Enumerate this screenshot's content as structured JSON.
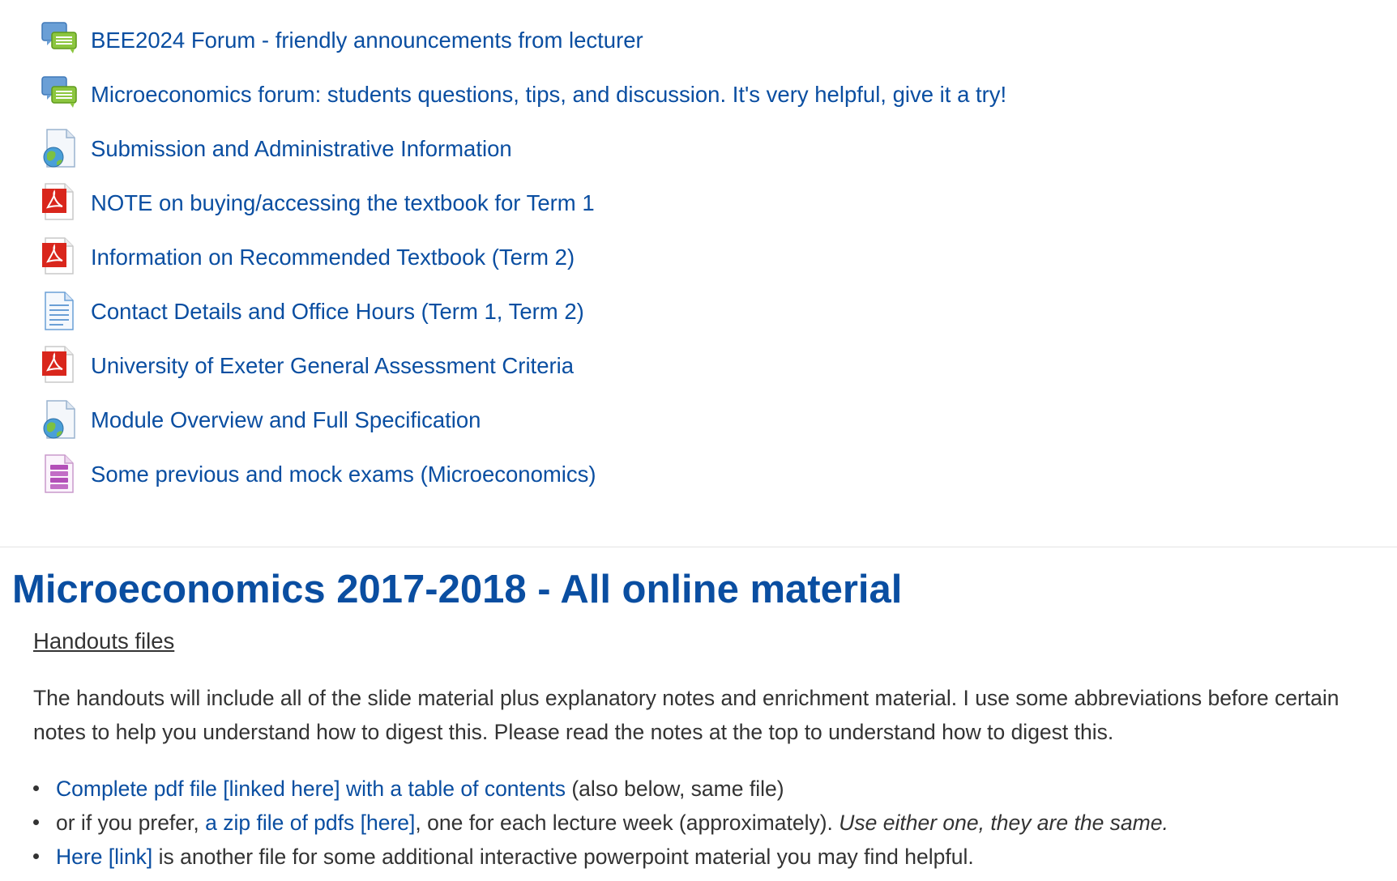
{
  "activities": [
    {
      "label": "BEE2024 Forum - friendly announcements from lecturer",
      "icon": "forum-icon"
    },
    {
      "label": "Microeconomics forum: students questions, tips, and discussion. It's very helpful, give it a try!",
      "icon": "forum-icon"
    },
    {
      "label": "Submission and Administrative Information",
      "icon": "url-globe-icon"
    },
    {
      "label": "NOTE on buying/accessing the textbook for Term 1",
      "icon": "pdf-icon"
    },
    {
      "label": "Information on Recommended Textbook (Term 2)",
      "icon": "pdf-icon"
    },
    {
      "label": "Contact Details and Office Hours (Term 1, Term 2)",
      "icon": "page-icon"
    },
    {
      "label": "University of Exeter General Assessment Criteria",
      "icon": "pdf-icon"
    },
    {
      "label": "Module Overview and Full Specification",
      "icon": "url-globe-icon"
    },
    {
      "label": "Some previous and mock exams (Microeconomics)",
      "icon": "archive-icon"
    }
  ],
  "section": {
    "title": "Microeconomics 2017-2018 - All online material",
    "handouts_heading": "Handouts files",
    "intro": "The handouts will include all of the slide material plus explanatory notes and enrichment material. I use some abbreviations before certain notes to help you understand how to digest this. Please read the notes at the top to understand how to digest this.",
    "bullets": [
      {
        "link": "Complete pdf file [linked here] with a table of contents",
        "after": " (also below, same file)"
      },
      {
        "before": "or if you prefer, ",
        "link": "a zip file of pdfs [here]",
        "after": ", one for each lecture week (approximately). ",
        "italic": "Use either one, they are the same."
      },
      {
        "link": "Here [link]",
        "after": " is another file for some additional interactive powerpoint material you may find helpful."
      }
    ]
  },
  "colors": {
    "link": "#0a4ea1",
    "text": "#333333",
    "forum_back": "#6a9fd6",
    "forum_front": "#8cc63f",
    "pdf_red": "#d9261c",
    "globe": "#4a9fd8",
    "archive": "#b34fb8"
  }
}
